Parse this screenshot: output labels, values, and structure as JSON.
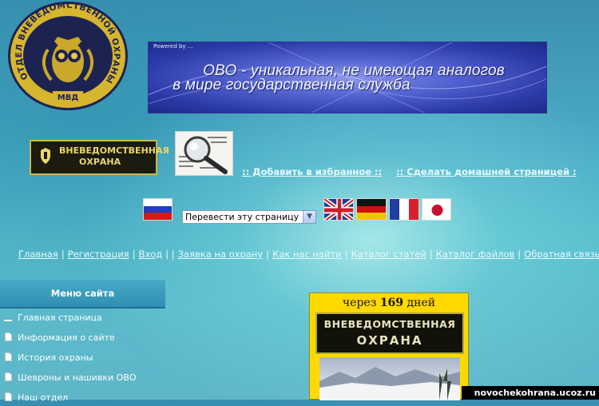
{
  "emblem": {
    "name": "ovd-emblem",
    "arc_text": "ОТДЕЛ ВНЕВЕДОМСТВЕННОЙ ОХРАНЫ",
    "bottom_text": "МВД"
  },
  "banner": {
    "powered": "Powered by ...",
    "line1": "ОВО - уникальная, не имеющая аналогов",
    "line2": "в мире государственная служба"
  },
  "badge_small": {
    "line1": "ВНЕВЕДОМСТВЕННАЯ",
    "line2": "ОХРАНА"
  },
  "links": {
    "favorites": ":: Добавить в избранное  ::",
    "homepage": ":: Сделать домашней страницей :"
  },
  "translate": {
    "selected": "Перевести эту страницу",
    "flags": [
      "ru",
      "en",
      "de",
      "fr",
      "jp"
    ]
  },
  "nav": {
    "items": [
      "Главная",
      "Регистрация",
      "Вход",
      "Заявка на охрану",
      "Как нас найти",
      "Каталог статей",
      "Каталог файлов",
      "Обратная связь"
    ]
  },
  "sidebar": {
    "title": "Меню сайта",
    "items": [
      {
        "label": "Главная страница",
        "icon": "dash-icon"
      },
      {
        "label": "Информация о сайте",
        "icon": "document-icon"
      },
      {
        "label": "История охраны",
        "icon": "document-icon"
      },
      {
        "label": "Шевроны и нашивки ОВО",
        "icon": "document-icon"
      },
      {
        "label": "Наш отдел",
        "icon": "document-icon"
      }
    ]
  },
  "countdown": {
    "prefix": "через",
    "days": "169",
    "suffix": "дней",
    "patch_line1": "ВНЕВЕДОМСТВЕННАЯ",
    "patch_line2": "ОХРАНА"
  },
  "watermark": "novochekohrana.ucoz.ru",
  "colors": {
    "link": "#e8fbff",
    "badge_gold": "#e9d86a",
    "widget_yellow": "#ffd900"
  }
}
